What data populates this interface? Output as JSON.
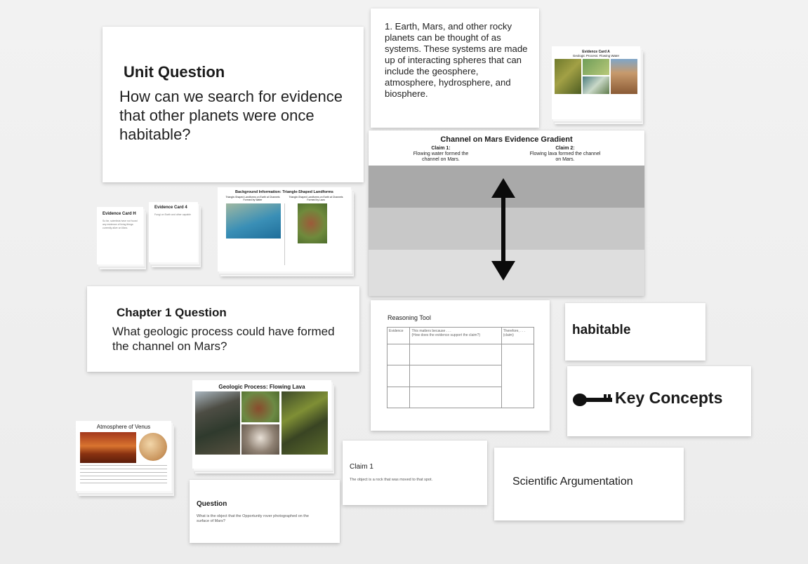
{
  "unit_question": {
    "heading": "Unit Question",
    "text": "How can we search for evidence that other planets were once habitable?"
  },
  "systems_card": {
    "text": "1. Earth, Mars, and other rocky planets can be thought of as systems. These systems are made up of interacting spheres that can include the geosphere, atmosphere, hydrosphere, and biosphere."
  },
  "evidence_card_a": {
    "title": "Evidence Card A",
    "subtitle": "Geologic Process: Flowing Water"
  },
  "gradient": {
    "title": "Channel on Mars Evidence Gradient",
    "claim1_head": "Claim 1:",
    "claim1_text": "Flowing water formed the channel on Mars.",
    "claim2_head": "Claim 2:",
    "claim2_text": "Flowing lava formed the channel on Mars."
  },
  "evidence_card_h": {
    "title": "Evidence Card H",
    "text": "So far, scientists have not found any evidence of living things currently alive on Mars."
  },
  "evidence_card_4": {
    "title": "Evidence Card 4",
    "text": "Fungi on Earth and other capable"
  },
  "landforms": {
    "title": "Background Information: Triangle-Shaped Landforms",
    "left_caption": "Triangle-Shaped Landforms on Earth at Channels Formed by Water",
    "right_caption": "Triangle-Shaped Landforms on Earth at Channels Formed by Lava"
  },
  "chapter_question": {
    "heading": "Chapter 1 Question",
    "text": "What geologic process could have formed the channel on Mars?"
  },
  "reasoning_tool": {
    "title": "Reasoning Tool",
    "col1": "Evidence",
    "col2": "This matters because . . .",
    "col2_sub": "(How does the evidence support the claim?)",
    "col3": "Therefore, . . .",
    "col3_sub": "(claim)"
  },
  "habitable": {
    "text": "habitable"
  },
  "key_concepts": {
    "text": "Key Concepts"
  },
  "venus": {
    "title": "Atmosphere of Venus"
  },
  "lava_card": {
    "title": "Geologic Process: Flowing Lava"
  },
  "claim_card": {
    "heading": "Claim 1",
    "text": "The object is a rock that was moved to that spot."
  },
  "argumentation": {
    "text": "Scientific Argumentation"
  },
  "question_card": {
    "heading": "Question",
    "text": "What is the object that the Opportunity rover photographed on the surface of Mars?"
  },
  "colors": {
    "background": "#efefef",
    "card": "#ffffff",
    "gradient_dark": "#a8a8a8",
    "gradient_mid": "#c8c8c8",
    "gradient_light": "#dcdcdc"
  }
}
